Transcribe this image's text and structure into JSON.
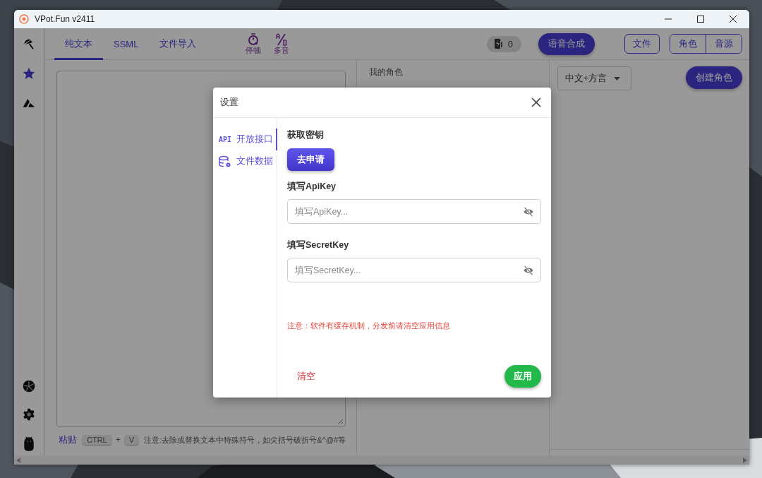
{
  "window": {
    "title": "VPot.Fun v2411"
  },
  "sidebar": {
    "items": [
      {
        "selected": false
      },
      {
        "selected": true
      },
      {
        "selected": false
      }
    ]
  },
  "toolbar": {
    "tabs": [
      {
        "label": "纯文本",
        "selected": true
      },
      {
        "label": "SSML",
        "selected": false
      },
      {
        "label": "文件导入",
        "selected": false
      }
    ],
    "tools": [
      {
        "kind": "pause",
        "label": "停顿"
      },
      {
        "kind": "polyphone",
        "label": "多音"
      }
    ],
    "counter": "0",
    "synth_button": "语音合成",
    "file_button": "文件",
    "segments": [
      {
        "label": "角色"
      },
      {
        "label": "音源"
      }
    ]
  },
  "editor": {
    "paste_label": "粘贴",
    "keys": [
      "CTRL",
      "V"
    ],
    "plus": "+",
    "note": "注意:去除或替换文本中特殊符号，如尖括号破折号&^@#等"
  },
  "roles_panel": {
    "title": "我的角色"
  },
  "right_panel": {
    "language": "中文+方言",
    "create_button": "创建角色"
  },
  "dialog": {
    "title": "设置",
    "nav": [
      {
        "kind": "api",
        "icon_text": "API",
        "label": "开放接口",
        "selected": true
      },
      {
        "kind": "data",
        "label": "文件数据",
        "selected": false
      }
    ],
    "section_title": "获取密钥",
    "request_button": "去申请",
    "fields": [
      {
        "label": "填写ApiKey",
        "placeholder": "填写ApiKey..."
      },
      {
        "label": "填写SecretKey",
        "placeholder": "填写SecretKey..."
      }
    ],
    "warning": "注意：软件有缓存机制，分发前请清空应用信息",
    "clear_button": "清空",
    "apply_button": "应用"
  }
}
